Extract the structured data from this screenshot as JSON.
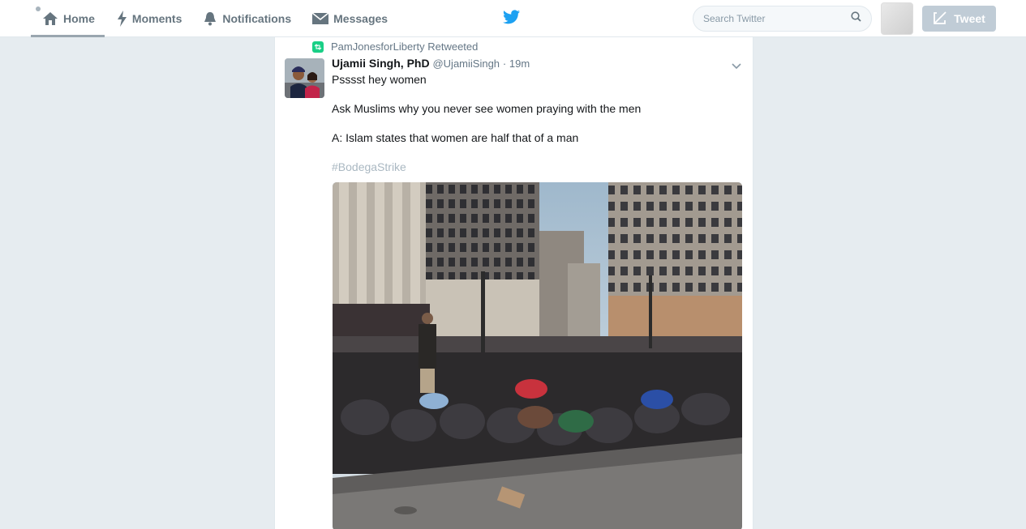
{
  "nav": {
    "home": "Home",
    "moments": "Moments",
    "notifications": "Notifications",
    "messages": "Messages"
  },
  "search": {
    "placeholder": "Search Twitter"
  },
  "tweet_button": "Tweet",
  "tweet": {
    "retweeted_by": "PamJonesforLiberty Retweeted",
    "name": "Ujamii Singh, PhD",
    "handle": "@UjamiiSingh",
    "time": "· 19m",
    "line1": "Psssst hey women",
    "line2": "Ask Muslims why you never see women praying with the men",
    "line3": "A: Islam states that women are half that of a man",
    "hashtag": "#BodegaStrike"
  },
  "colors": {
    "brand": "#1da1f2",
    "retweet": "#19cf86"
  }
}
